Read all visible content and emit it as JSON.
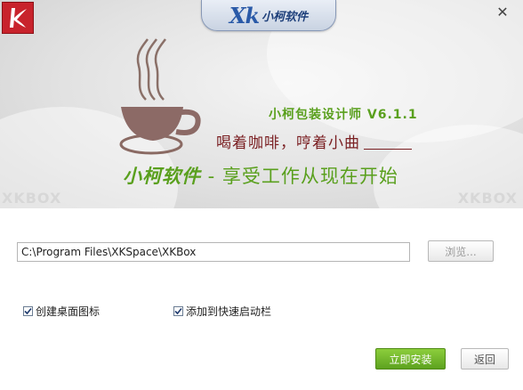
{
  "header": {
    "tab_logo_text": "Xk",
    "tab_name": "小柯软件",
    "close_icon": "close-icon"
  },
  "banner": {
    "product_title": "小柯包装设计师 V6.1.1",
    "lyric_text": "喝着咖啡，哼着小曲",
    "slogan_brand": "小柯软件",
    "slogan_text": " - 享受工作从现在开始",
    "watermark_left": "XKBOX",
    "watermark_right": "XKBOX",
    "cup_icon": "coffee-cup-icon",
    "colors": {
      "green": "#5aa01e",
      "dark_red": "#7a1f22",
      "logo_red": "#c8232c"
    }
  },
  "install": {
    "path_value": "C:\\Program Files\\XKSpace\\XKBox",
    "browse_label": "浏览...",
    "checkbox_desktop": {
      "label": "创建桌面图标",
      "checked": true
    },
    "checkbox_quicklaunch": {
      "label": "添加到快速启动栏",
      "checked": true
    },
    "install_label": "立即安装",
    "back_label": "返回"
  }
}
